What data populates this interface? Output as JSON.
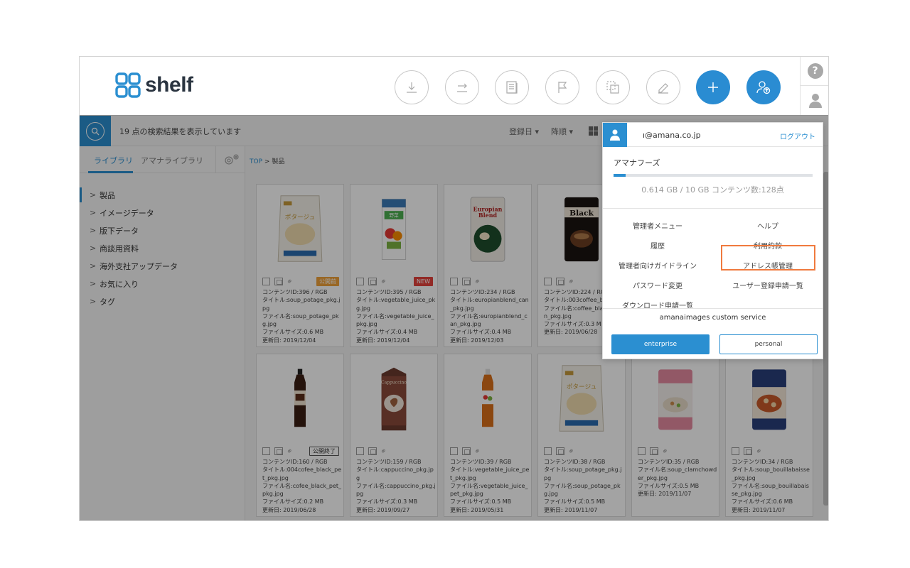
{
  "brand": {
    "name": "shelf",
    "accent": "#2b8fd1"
  },
  "header": {
    "buttons": [
      {
        "name": "download-button",
        "icon": "download-icon"
      },
      {
        "name": "share-button",
        "icon": "share-icon"
      },
      {
        "name": "document-button",
        "icon": "document-icon"
      },
      {
        "name": "flag-button",
        "icon": "flag-icon"
      },
      {
        "name": "collection-button",
        "icon": "collection-icon"
      },
      {
        "name": "edit-button",
        "icon": "pencil-icon"
      },
      {
        "name": "add-button",
        "icon": "plus-icon"
      },
      {
        "name": "user-upload-button",
        "icon": "user-upload-icon"
      }
    ],
    "help_label": "?"
  },
  "toolbar": {
    "result_text": "19 点の検索結果を表示しています",
    "sort_field": "登録日 ▾",
    "sort_order": "降順 ▾"
  },
  "sidebar": {
    "tabs": [
      "ライブラリ",
      "アマナライブラリ"
    ],
    "tree": [
      "製品",
      "イメージデータ",
      "版下データ",
      "商談用資料",
      "海外支社アップデータ",
      "お気に入り",
      "タグ"
    ],
    "chevron": ">"
  },
  "breadcrumb": {
    "root": "TOP",
    "separator": ">",
    "current": "製品"
  },
  "cards": [
    {
      "badge": "公開前",
      "badge_style": "orange",
      "lines": [
        "コンテンツID:396 / RGB",
        "タイトル:soup_potage_pkg.jpg",
        "ファイル名:soup_potage_pkg.jpg",
        "ファイルサイズ:0.6 MB",
        "更新日: 2019/12/04"
      ],
      "thumb": "pouch-cream"
    },
    {
      "badge": "NEW",
      "badge_style": "red",
      "lines": [
        "コンテンツID:395 / RGB",
        "タイトル:vegetable_juice_pkg.jpg",
        "ファイル名:vegetable_juice_pkg.jpg",
        "ファイルサイズ:0.4 MB",
        "更新日: 2019/12/04"
      ],
      "thumb": "carton-green"
    },
    {
      "badge": "",
      "badge_style": "",
      "lines": [
        "コンテンツID:234 / RGB",
        "タイトル:europianblend_can_pkg.jpg",
        "ファイル名:europianblend_can_pkg.jpg",
        "ファイルサイズ:0.4 MB",
        "更新日: 2019/12/03"
      ],
      "thumb": "can-white"
    },
    {
      "badge": "",
      "badge_style": "",
      "lines": [
        "コンテンツID:224 / RGB",
        "タイトル:003coffee_bl",
        "ファイル名:coffee_blac",
        "n_pkg.jpg",
        "ファイルサイズ:0.3 M",
        "更新日: 2019/06/28"
      ],
      "thumb": "can-black"
    },
    {
      "badge": "公開終了",
      "badge_style": "outline",
      "lines": [
        "コンテンツID:160 / RGB",
        "タイトル:004cofee_black_pet_pkg.jpg",
        "ファイル名:cofee_black_pet_pkg.jpg",
        "ファイルサイズ:0.2 MB",
        "更新日: 2019/06/28"
      ],
      "thumb": "bottle-dark"
    },
    {
      "badge": "",
      "badge_style": "",
      "lines": [
        "コンテンツID:159 / RGB",
        "タイトル:cappuccino_pkg.jpg",
        "ファイル名:cappuccino_pkg.jpg",
        "ファイルサイズ:0.3 MB",
        "更新日: 2019/09/27"
      ],
      "thumb": "carton-brown"
    },
    {
      "badge": "",
      "badge_style": "",
      "lines": [
        "コンテンツID:39 / RGB",
        "タイトル:vegetable_juice_pet_pkg.jpg",
        "ファイル名:vegetable_juice_pet_pkg.jpg",
        "ファイルサイズ:0.5 MB",
        "更新日: 2019/05/31"
      ],
      "thumb": "bottle-orange"
    },
    {
      "badge": "",
      "badge_style": "",
      "lines": [
        "コンテンツID:38 / RGB",
        "タイトル:soup_potage_pkg.jpg",
        "ファイル名:soup_potage_pkg.jpg",
        "ファイルサイズ:0.5 MB",
        "更新日: 2019/11/07"
      ],
      "thumb": "pouch-cream"
    },
    {
      "badge": "",
      "badge_style": "",
      "lines": [
        "コンテンツID:35 / RGB",
        "ファイル名:soup_clamchowder_pkg.jpg",
        "ファイルサイズ:0.5 MB",
        "更新日: 2019/11/07"
      ],
      "thumb": "can-pink"
    },
    {
      "badge": "",
      "badge_style": "",
      "lines": [
        "コンテンツID:34 / RGB",
        "タイトル:soup_bouillabaisse_pkg.jpg",
        "ファイル名:soup_bouillabaisse_pkg.jpg",
        "ファイルサイズ:0.6 MB",
        "更新日: 2019/11/07"
      ],
      "thumb": "can-blue"
    }
  ],
  "dropdown": {
    "email": "ı@amana.co.jp",
    "logout": "ログアウト",
    "org": "アマナフーズ",
    "usage": "0.614 GB / 10 GB  コンテンツ数:128点",
    "usage_fraction": 0.06,
    "menu": [
      [
        "管理者メニュー",
        "ヘルプ"
      ],
      [
        "履歴",
        "利用約款"
      ],
      [
        "管理者向けガイドライン",
        "アドレス帳管理"
      ],
      [
        "パスワード変更",
        "ユーザー登録申請一覧"
      ],
      [
        "ダウンロード申請一覧",
        ""
      ]
    ],
    "highlighted": "アドレス帳管理",
    "highlight_color": "#f07a3e",
    "custom_service": "amanaimages custom service",
    "btn_enterprise": "enterprise",
    "btn_personal": "personal"
  }
}
